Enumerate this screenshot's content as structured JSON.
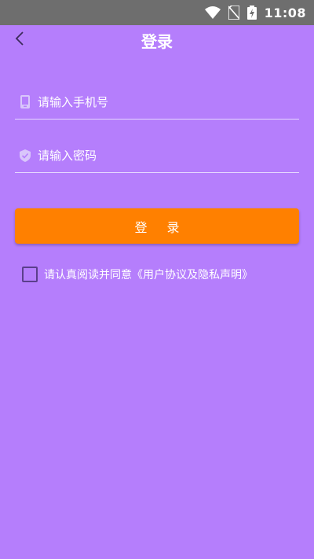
{
  "status_bar": {
    "time": "11:08"
  },
  "header": {
    "title": "登录"
  },
  "form": {
    "phone": {
      "placeholder": "请输入手机号",
      "value": ""
    },
    "password": {
      "placeholder": "请输入密码",
      "value": ""
    },
    "login_label": "登 录"
  },
  "agreement": {
    "prefix": "请认真阅读并同意",
    "link": "《用户协议及隐私声明》",
    "checked": false
  },
  "colors": {
    "background": "#b57efc",
    "status_bar": "#6e6e6e",
    "accent": "#ff8000"
  },
  "icons": [
    "wifi-icon",
    "no-sim-icon",
    "battery-charging-icon",
    "back-arrow-icon",
    "phone-icon",
    "shield-icon"
  ]
}
